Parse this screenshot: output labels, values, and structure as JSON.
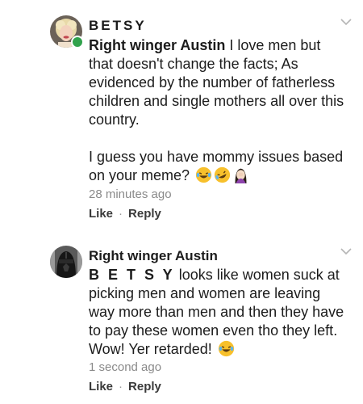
{
  "comments": [
    {
      "author": "BETSY",
      "mention": "Right winger Austin",
      "text_first": " I love men but that doesn't change the facts; As evidenced by the number of fatherless children and single mothers all over this country.",
      "text_second": "I guess you have mommy issues based on your meme?",
      "emojis": [
        "laughing-crying-emoji",
        "rofl-emoji",
        "facepalm-woman-emoji"
      ],
      "timestamp": "28 minutes ago",
      "like_label": "Like",
      "reply_label": "Reply",
      "online": true
    },
    {
      "author": "Right winger Austin",
      "mention": "B E T S Y",
      "text": " looks like women suck at picking men and women are leaving way more than men and then they have to pay these women even tho they left. Wow! Yer retarded!",
      "emojis": [
        "laughing-crying-emoji"
      ],
      "timestamp": "1 second ago",
      "like_label": "Like",
      "reply_label": "Reply"
    }
  ],
  "separator": "·",
  "colors": {
    "online": "#31a24c",
    "meta_text": "#8a8a8a",
    "action_text": "#3a3a3a"
  }
}
